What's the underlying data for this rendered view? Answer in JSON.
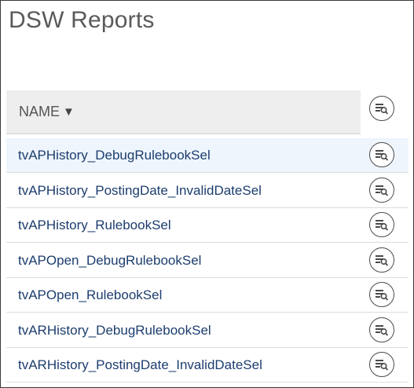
{
  "page": {
    "title": "DSW Reports"
  },
  "table": {
    "column_header": "NAME",
    "sort_indicator": "▼",
    "rows": [
      {
        "name": "tvAPHistory_DebugRulebookSel",
        "selected": true
      },
      {
        "name": "tvAPHistory_PostingDate_InvalidDateSel",
        "selected": false
      },
      {
        "name": "tvAPHistory_RulebookSel",
        "selected": false
      },
      {
        "name": "tvAPOpen_DebugRulebookSel",
        "selected": false
      },
      {
        "name": "tvAPOpen_RulebookSel",
        "selected": false
      },
      {
        "name": "tvARHistory_DebugRulebookSel",
        "selected": false
      },
      {
        "name": "tvARHistory_PostingDate_InvalidDateSel",
        "selected": false
      }
    ]
  },
  "icons": {
    "row_action": "report-view-icon",
    "header_action": "report-view-icon"
  },
  "colors": {
    "link": "#1c3d6e",
    "title": "#5a5a5a",
    "header_bg": "#eeeeee",
    "selected_row_bg": "#eef5fc"
  }
}
